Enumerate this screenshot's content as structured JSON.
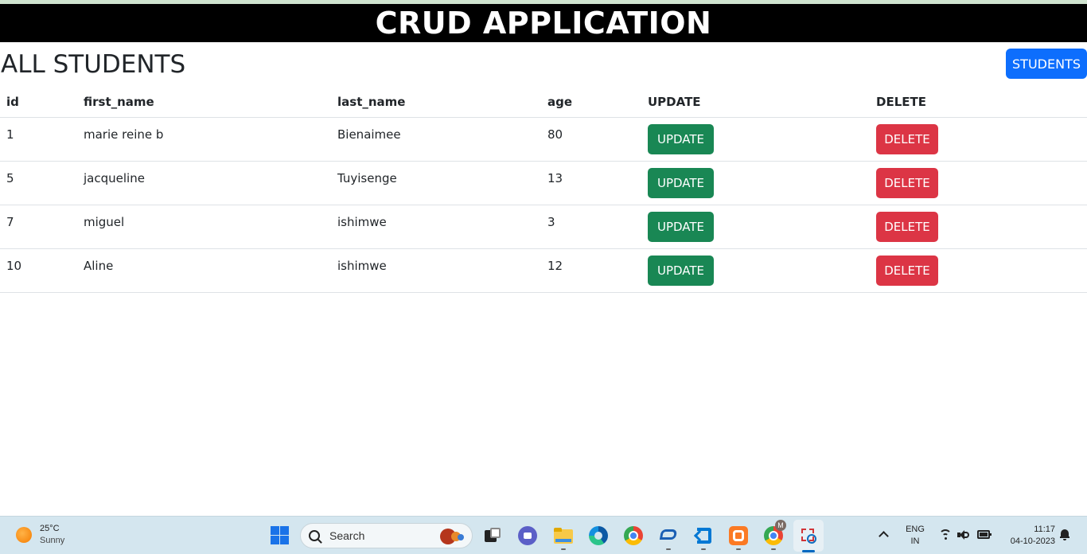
{
  "app": {
    "title": "CRUD APPLICATION"
  },
  "page": {
    "title": "ALL STUDENTS",
    "students_button": "STUDENTS"
  },
  "table": {
    "headers": [
      "id",
      "first_name",
      "last_name",
      "age",
      "UPDATE",
      "DELETE"
    ],
    "rows": [
      {
        "id": "1",
        "first_name": "marie reine b",
        "last_name": "Bienaimee",
        "age": "80",
        "update": "UPDATE",
        "delete": "DELETE"
      },
      {
        "id": "5",
        "first_name": "jacqueline",
        "last_name": "Tuyisenge",
        "age": "13",
        "update": "UPDATE",
        "delete": "DELETE"
      },
      {
        "id": "7",
        "first_name": "miguel",
        "last_name": "ishimwe",
        "age": "3",
        "update": "UPDATE",
        "delete": "DELETE"
      },
      {
        "id": "10",
        "first_name": "Aline",
        "last_name": "ishimwe",
        "age": "12",
        "update": "UPDATE",
        "delete": "DELETE"
      }
    ]
  },
  "taskbar": {
    "weather": {
      "temp": "25°C",
      "condition": "Sunny",
      "icon": "sun-icon"
    },
    "search_placeholder": "Search",
    "apps": [
      "task-view-icon",
      "teams-chat-icon",
      "file-explorer-icon",
      "edge-icon",
      "chrome-icon",
      "screen-app-icon",
      "vscode-icon",
      "xampp-icon",
      "chrome-profile-icon",
      "snipping-tool-icon"
    ],
    "chrome_profile_badge": "M",
    "language": {
      "line1": "ENG",
      "line2": "IN"
    },
    "clock": {
      "time": "11:17",
      "date": "04-10-2023"
    }
  },
  "colors": {
    "header_bg": "#000000",
    "students_button": "#0d6efd",
    "update_button": "#198754",
    "delete_button": "#dc3545"
  }
}
